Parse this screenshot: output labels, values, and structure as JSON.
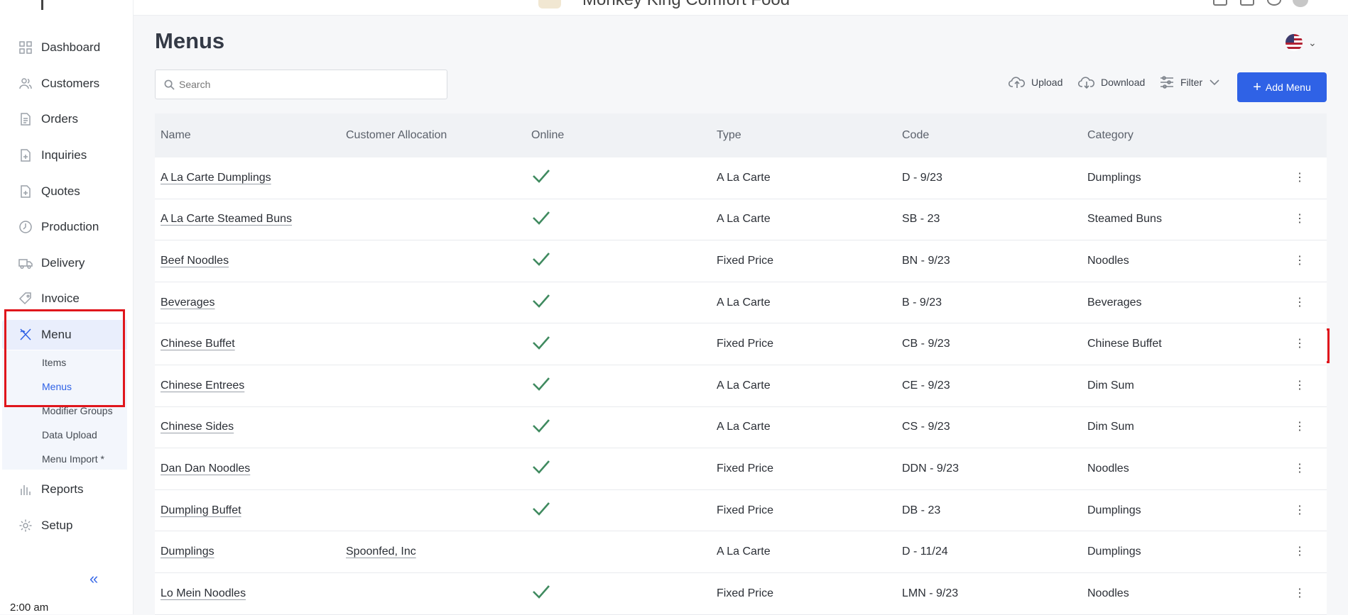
{
  "header": {
    "brand": "Monkey King Comfort Food"
  },
  "sidebar": {
    "items": [
      {
        "label": "Dashboard",
        "icon": "grid-icon"
      },
      {
        "label": "Customers",
        "icon": "users-icon"
      },
      {
        "label": "Orders",
        "icon": "document-icon"
      },
      {
        "label": "Inquiries",
        "icon": "document-plus-icon"
      },
      {
        "label": "Quotes",
        "icon": "document-plus-icon"
      },
      {
        "label": "Production",
        "icon": "clock-icon"
      },
      {
        "label": "Delivery",
        "icon": "truck-icon"
      },
      {
        "label": "Invoice",
        "icon": "tag-icon"
      },
      {
        "label": "Menu",
        "icon": "utensils-icon",
        "active": true
      },
      {
        "label": "Reports",
        "icon": "bar-chart-icon"
      },
      {
        "label": "Setup",
        "icon": "gear-icon"
      }
    ],
    "submenu": [
      "Items",
      "Menus",
      "Modifier Groups",
      "Data Upload",
      "Menu Import *"
    ],
    "current_sub": "Menus",
    "clock": "2:00 am"
  },
  "page": {
    "title": "Menus",
    "search_placeholder": "Search",
    "upload_label": "Upload",
    "download_label": "Download",
    "filter_label": "Filter",
    "add_label": "Add Menu"
  },
  "table": {
    "columns": [
      "Name",
      "Customer Allocation",
      "Online",
      "Type",
      "Code",
      "Category"
    ],
    "rows": [
      {
        "name": "A La Carte Dumplings",
        "allocation": "",
        "online": true,
        "type": "A La Carte",
        "code": "D - 9/23",
        "category": "Dumplings"
      },
      {
        "name": "A La Carte Steamed Buns",
        "allocation": "",
        "online": true,
        "type": "A La Carte",
        "code": "SB - 23",
        "category": "Steamed Buns"
      },
      {
        "name": "Beef Noodles",
        "allocation": "",
        "online": true,
        "type": "Fixed Price",
        "code": "BN - 9/23",
        "category": "Noodles"
      },
      {
        "name": "Beverages",
        "allocation": "",
        "online": true,
        "type": "A La Carte",
        "code": "B - 9/23",
        "category": "Beverages"
      },
      {
        "name": "Chinese Buffet",
        "allocation": "",
        "online": true,
        "type": "Fixed Price",
        "code": "CB - 9/23",
        "category": "Chinese Buffet"
      },
      {
        "name": "Chinese Entrees",
        "allocation": "",
        "online": true,
        "type": "A La Carte",
        "code": "CE - 9/23",
        "category": "Dim Sum"
      },
      {
        "name": "Chinese Sides",
        "allocation": "",
        "online": true,
        "type": "A La Carte",
        "code": "CS - 9/23",
        "category": "Dim Sum"
      },
      {
        "name": "Dan Dan Noodles",
        "allocation": "",
        "online": true,
        "type": "Fixed Price",
        "code": "DDN - 9/23",
        "category": "Noodles"
      },
      {
        "name": "Dumpling Buffet",
        "allocation": "",
        "online": true,
        "type": "Fixed Price",
        "code": "DB - 23",
        "category": "Dumplings"
      },
      {
        "name": "Dumplings",
        "allocation": "Spoonfed, Inc",
        "online": false,
        "type": "A La Carte",
        "code": "D - 11/24",
        "category": "Dumplings"
      },
      {
        "name": "Lo Mein Noodles",
        "allocation": "",
        "online": true,
        "type": "Fixed Price",
        "code": "LMN - 9/23",
        "category": "Noodles"
      }
    ]
  },
  "colors": {
    "accent": "#2f62e6",
    "highlight": "#e0161c",
    "check": "#3f8a5f"
  }
}
